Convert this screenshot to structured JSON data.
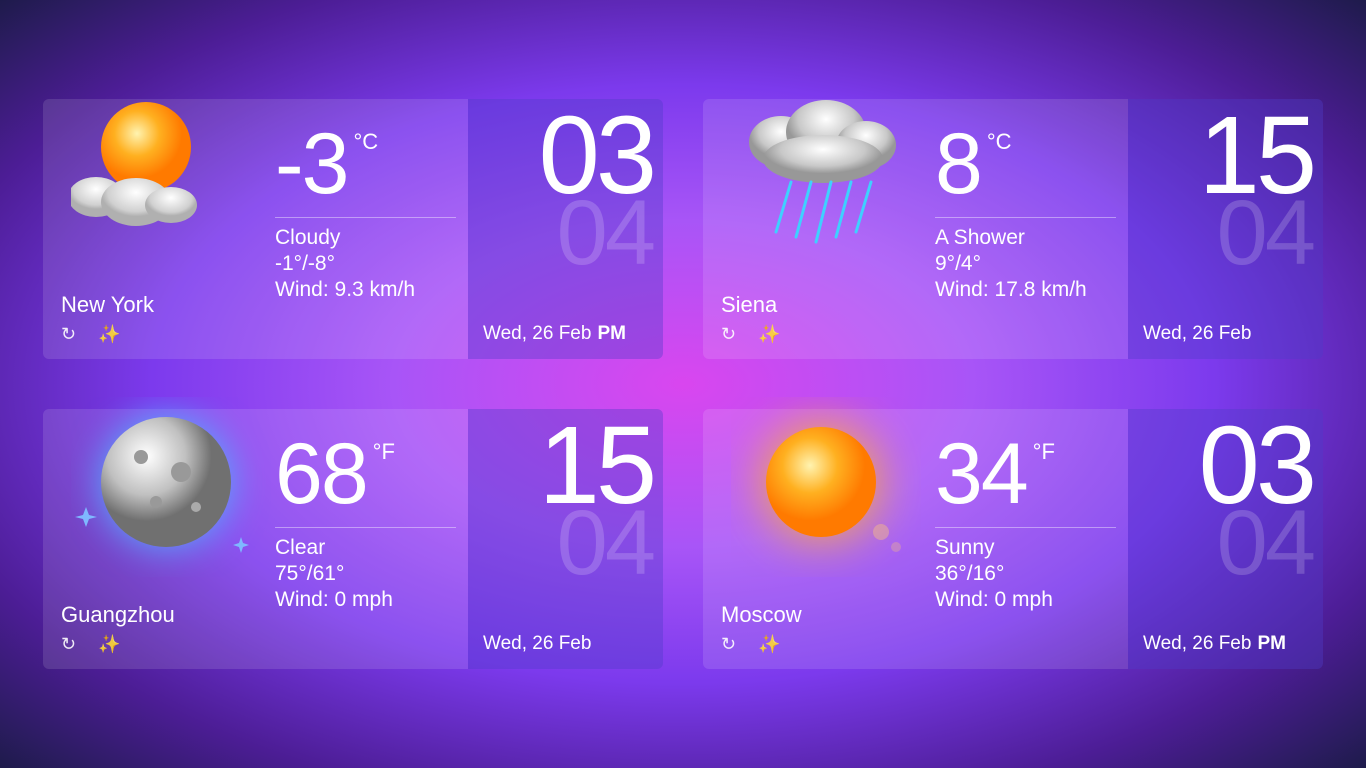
{
  "widgets": [
    {
      "city": "New York",
      "icon": "sun-cloud",
      "temp": "-3",
      "unit": "°C",
      "condition": "Cloudy",
      "range": "-1°/-8°",
      "wind": "Wind: 9.3 km/h",
      "time_main": "03",
      "time_ghost": "04",
      "date": "Wed, 26 Feb",
      "ampm": "PM"
    },
    {
      "city": "Siena",
      "icon": "rain-cloud",
      "temp": "8",
      "unit": "°C",
      "condition": "A Shower",
      "range": "9°/4°",
      "wind": "Wind: 17.8 km/h",
      "time_main": "15",
      "time_ghost": "04",
      "date": "Wed, 26 Feb",
      "ampm": ""
    },
    {
      "city": "Guangzhou",
      "icon": "moon",
      "temp": "68",
      "unit": "°F",
      "condition": "Clear",
      "range": "75°/61°",
      "wind": "Wind: 0 mph",
      "time_main": "15",
      "time_ghost": "04",
      "date": "Wed, 26 Feb",
      "ampm": ""
    },
    {
      "city": "Moscow",
      "icon": "sun",
      "temp": "34",
      "unit": "°F",
      "condition": "Sunny",
      "range": "36°/16°",
      "wind": "Wind: 0 mph",
      "time_main": "03",
      "time_ghost": "04",
      "date": "Wed, 26 Feb",
      "ampm": "PM"
    }
  ],
  "icons": {
    "refresh": "↻",
    "wand": "✨"
  }
}
